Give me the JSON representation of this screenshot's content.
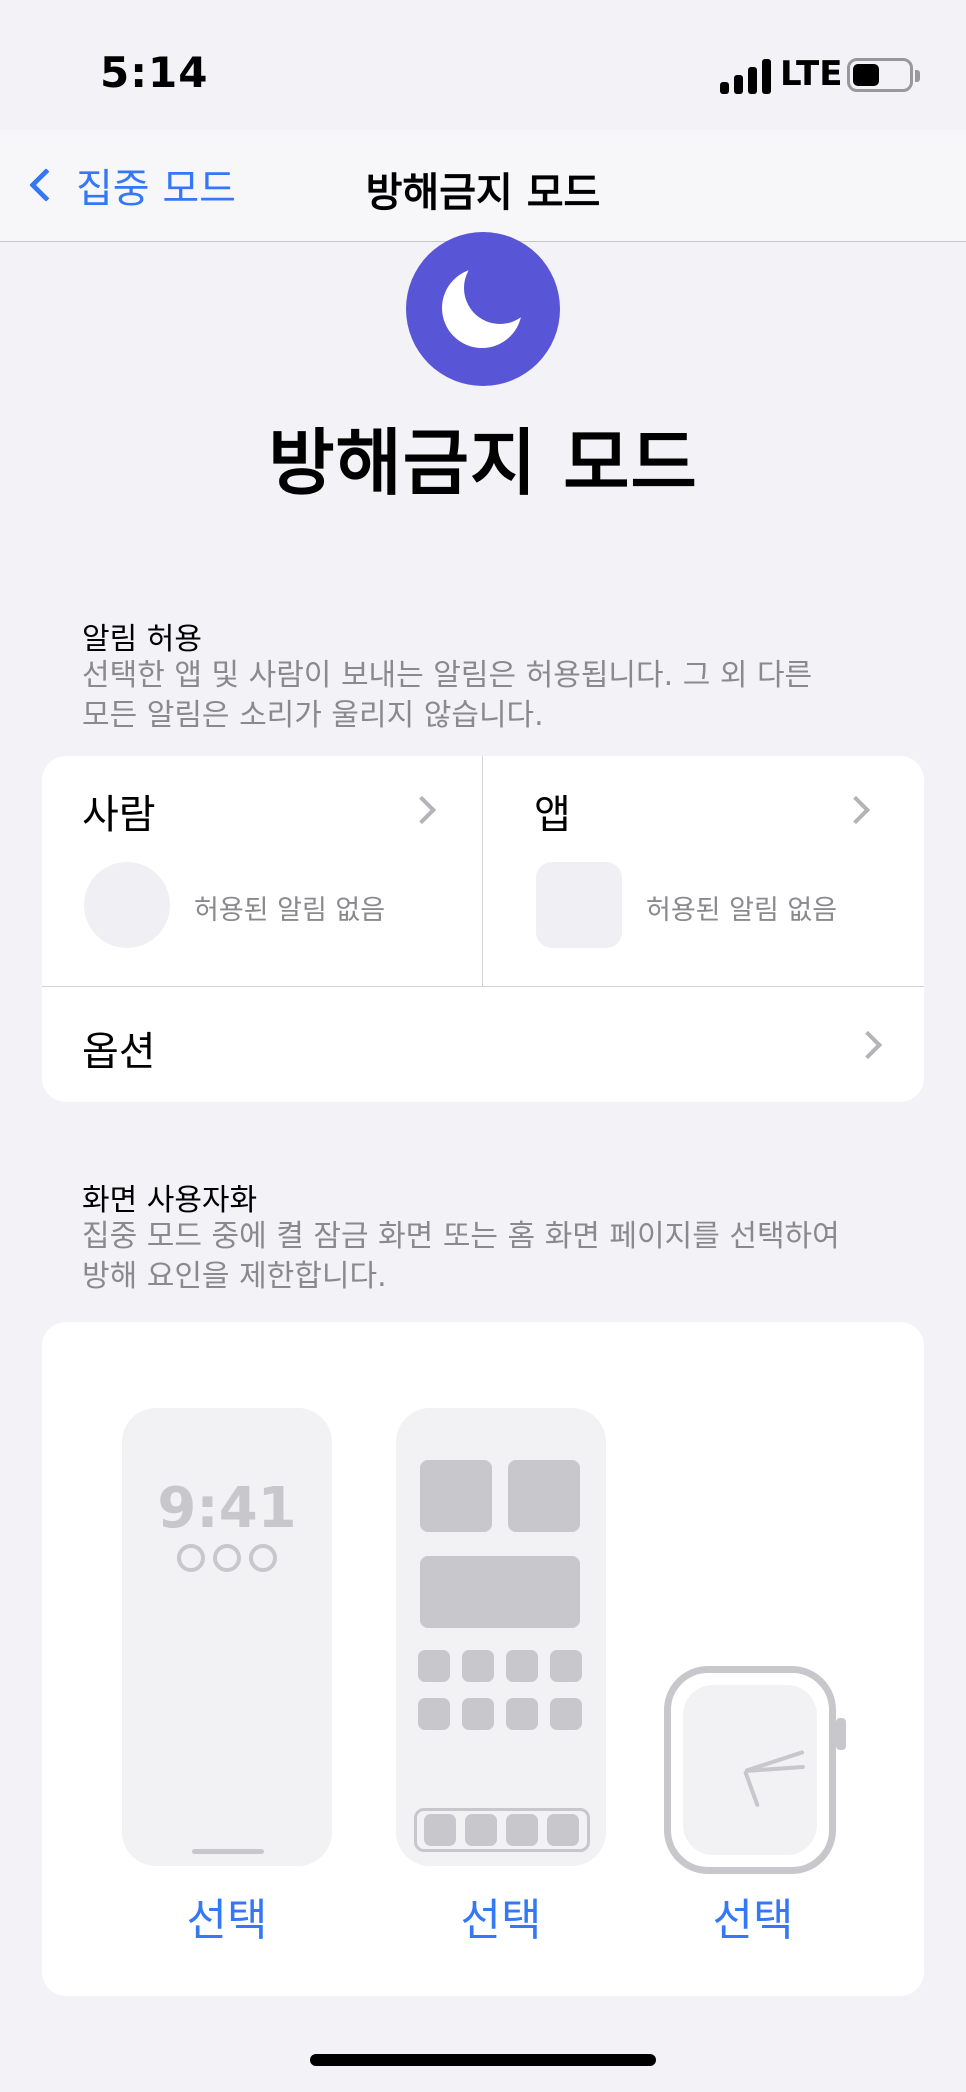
{
  "status_bar": {
    "time": "5:14",
    "network": "LTE"
  },
  "nav": {
    "back_label": "집중 모드",
    "title": "방해금지 모드"
  },
  "mode": {
    "name": "방해금지 모드",
    "icon": "moon-icon",
    "color": "#5856d6"
  },
  "allow_section": {
    "header": "알림 허용",
    "description_line1": "선택한 앱 및 사람이 보내는 알림은 허용됩니다. 그 외 다른",
    "description_line2": "모든 알림은 소리가 울리지 않습니다.",
    "people": {
      "label": "사람",
      "status": "허용된 알림 없음"
    },
    "apps": {
      "label": "앱",
      "status": "허용된 알림 없음"
    },
    "options_label": "옵션"
  },
  "customize_section": {
    "header": "화면 사용자화",
    "description_line1": "집중 모드 중에 켤 잠금 화면 또는 홈 화면 페이지를 선택하여",
    "description_line2": "방해 요인을 제한합니다.",
    "lock_screen_time": "9:41",
    "select_lock": "선택",
    "select_home": "선택",
    "select_watch": "선택"
  },
  "colors": {
    "accent": "#3478f6",
    "background": "#f2f2f7",
    "secondary_text": "#8a8a8e"
  }
}
